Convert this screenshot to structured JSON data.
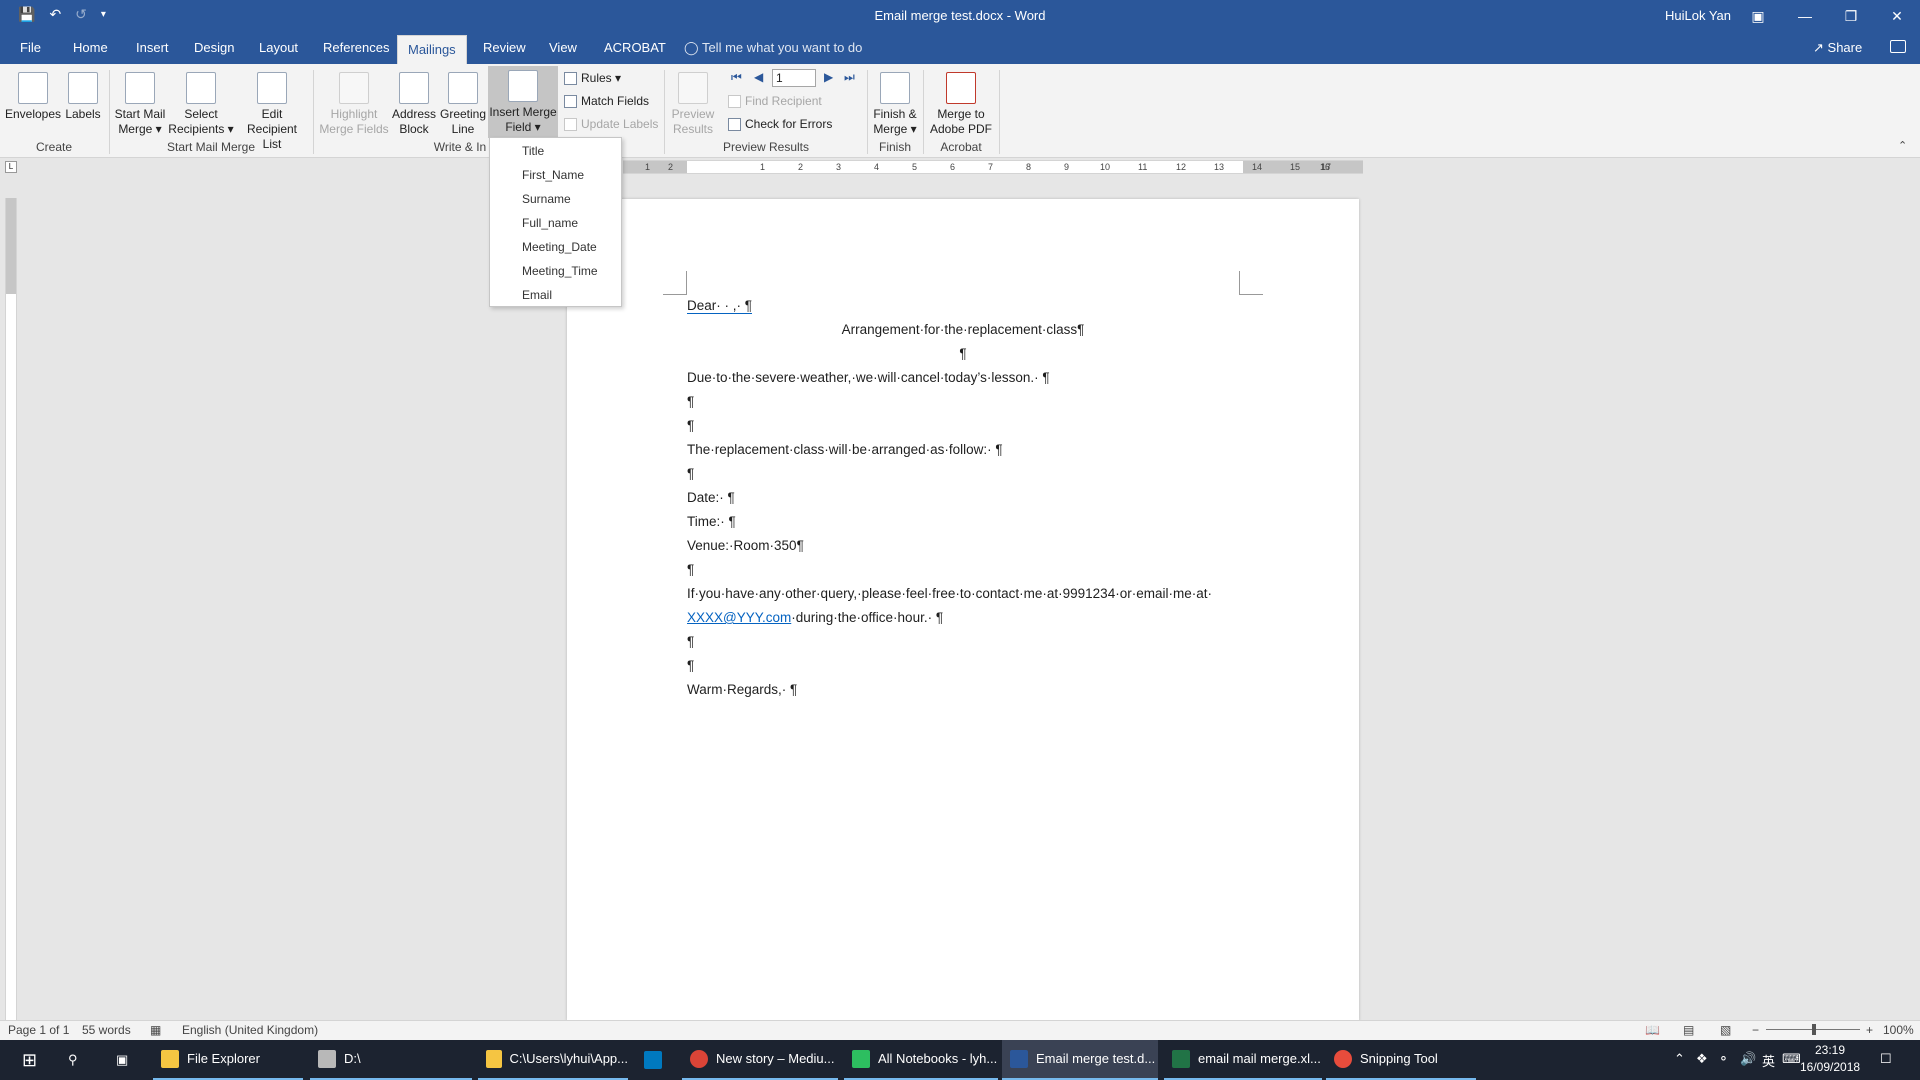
{
  "window": {
    "title": "Email merge test.docx  -  Word",
    "user": "HuiLok Yan"
  },
  "tabs": [
    "File",
    "Home",
    "Insert",
    "Design",
    "Layout",
    "References",
    "Mailings",
    "Review",
    "View",
    "ACROBAT"
  ],
  "active_tab": "Mailings",
  "tell_me": "Tell me what you want to do",
  "share_label": "Share",
  "ribbon": {
    "groups": {
      "create": "Create",
      "start_mail_merge": "Start Mail Merge",
      "write_insert": "Write & In",
      "preview_results": "Preview Results",
      "finish": "Finish",
      "acrobat": "Acrobat"
    },
    "envelopes": "Envelopes",
    "labels": "Labels",
    "start_mail_merge": [
      "Start Mail",
      "Merge ▾"
    ],
    "select_recipients": [
      "Select",
      "Recipients ▾"
    ],
    "edit_recipient_list": [
      "Edit",
      "Recipient List"
    ],
    "highlight_merge_fields": [
      "Highlight",
      "Merge Fields"
    ],
    "address_block": [
      "Address",
      "Block"
    ],
    "greeting_line": [
      "Greeting",
      "Line"
    ],
    "insert_merge_field": [
      "Insert Merge",
      "Field ▾"
    ],
    "rules": "Rules ▾",
    "match_fields": "Match Fields",
    "update_labels": "Update Labels",
    "preview_results": [
      "Preview",
      "Results"
    ],
    "record_number": "1",
    "find_recipient": "Find Recipient",
    "check_for_errors": "Check for Errors",
    "finish_merge": [
      "Finish &",
      "Merge ▾"
    ],
    "merge_to_pdf": [
      "Merge to",
      "Adobe PDF"
    ]
  },
  "merge_fields": [
    "Title",
    "First_Name",
    "Surname",
    "Full_name",
    "Meeting_Date",
    "Meeting_Time",
    "Email"
  ],
  "ruler_ticks": [
    "1",
    "2",
    "1",
    "2",
    "3",
    "4",
    "5",
    "6",
    "7",
    "8",
    "9",
    "10",
    "11",
    "12",
    "13",
    "14",
    "15",
    "16",
    "17"
  ],
  "document": {
    "dear": "Dear· · ,· ¶",
    "heading": "Arrangement·for·the·replacement·class¶",
    "blank": "¶",
    "line1": "Due·to·the·severe·weather,·we·will·cancel·today’s·lesson.· ¶",
    "line2": "The·replacement·class·will·be·arranged·as·follow:· ¶",
    "date": "Date:· ¶",
    "time": "Time:· ¶",
    "venue": "Venue:·Room·350¶",
    "query": "If·you·have·any·other·query,·please·feel·free·to·contact·me·at·9991234·or·email·me·at·",
    "email_link": "XXXX@YYY.com",
    "query_end": "·during·the·office·hour.· ¶",
    "regards": "Warm·Regards,· ¶"
  },
  "status": {
    "page": "Page 1 of 1",
    "words": "55 words",
    "language": "English (United Kingdom)",
    "zoom": "100%"
  },
  "taskbar": {
    "file_explorer": "File Explorer",
    "drive": "D:\\",
    "folder": "C:\\Users\\lyhui\\App...",
    "chrome": "New story – Mediu...",
    "onenote": "All Notebooks - lyh...",
    "word": "Email merge test.d...",
    "excel": "email mail merge.xl...",
    "snipping": "Snipping Tool",
    "time": "23:19",
    "date": "16/09/2018"
  },
  "colors": {
    "word_blue": "#2b579a",
    "link_blue": "#0563c1",
    "taskbar": "#1c2330"
  }
}
